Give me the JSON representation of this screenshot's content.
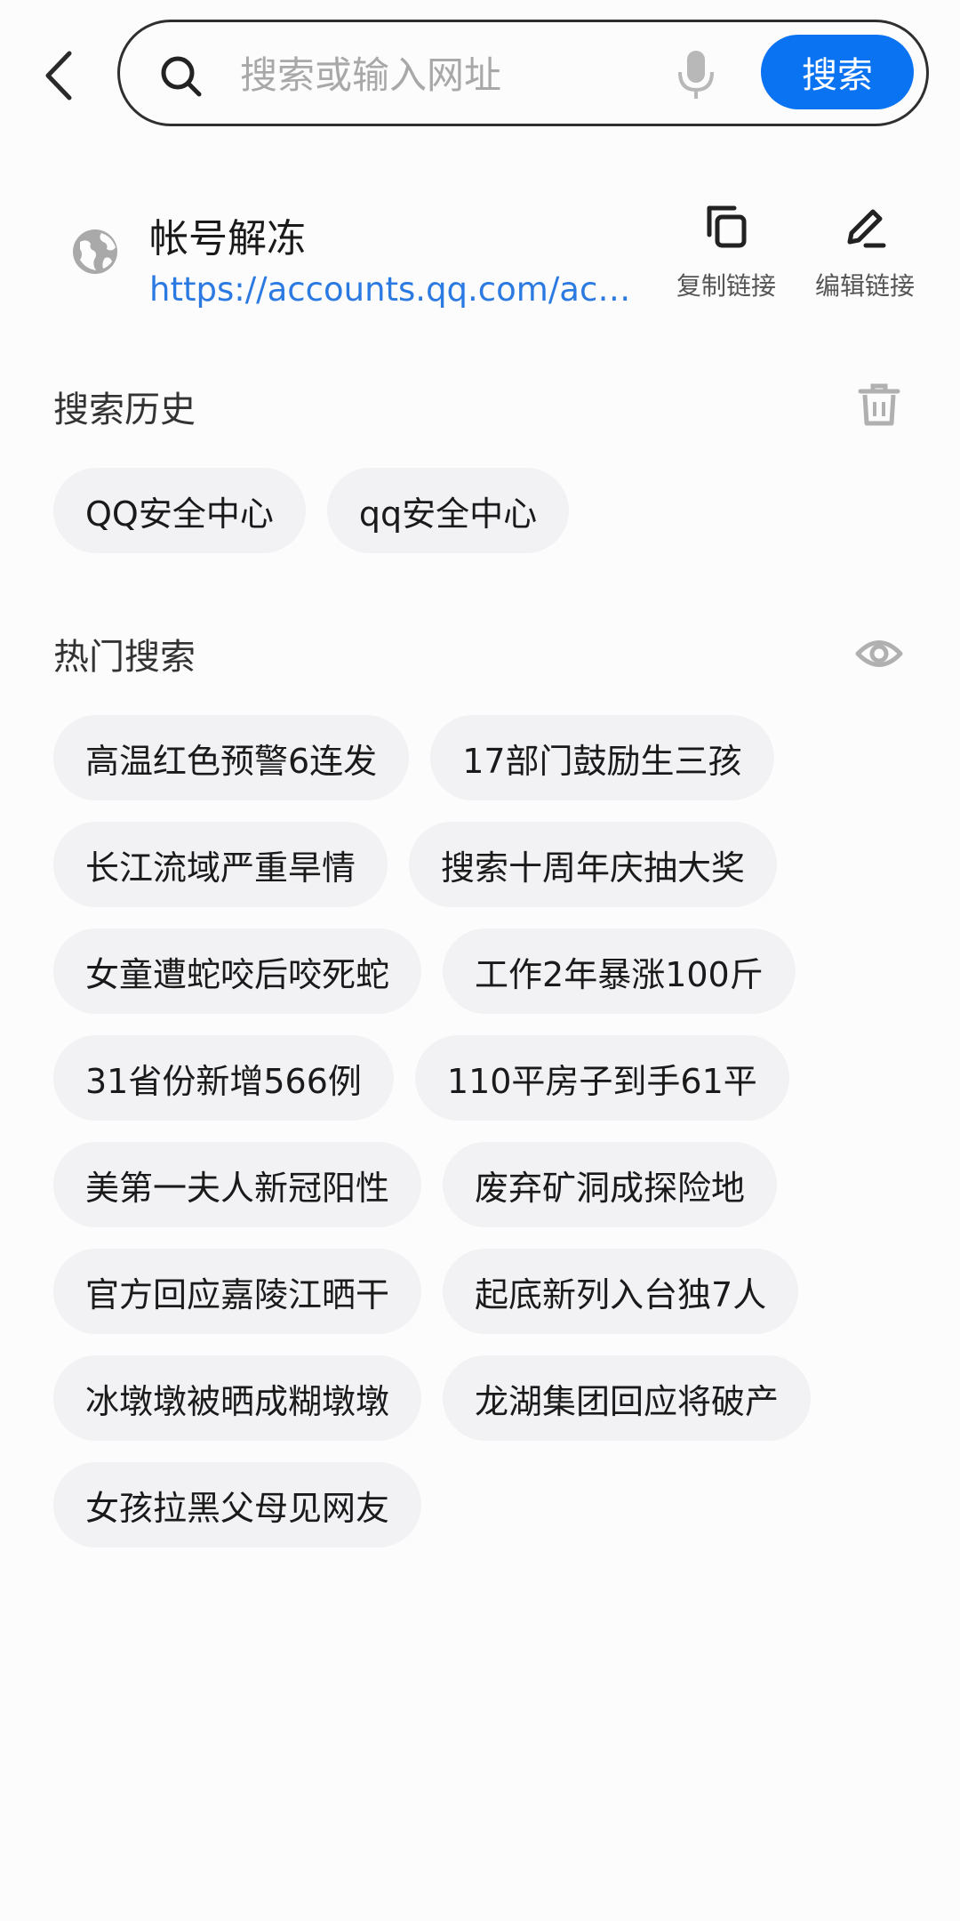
{
  "search": {
    "placeholder": "搜索或输入网址",
    "button_label": "搜索"
  },
  "current_page": {
    "title": "帐号解冻",
    "url": "https://accounts.qq.com/acc…",
    "copy_label": "复制链接",
    "edit_label": "编辑链接"
  },
  "history": {
    "title": "搜索历史",
    "items": [
      "QQ安全中心",
      "qq安全中心"
    ]
  },
  "hot": {
    "title": "热门搜索",
    "items": [
      "高温红色预警6连发",
      "17部门鼓励生三孩",
      "长江流域严重旱情",
      "搜索十周年庆抽大奖",
      "女童遭蛇咬后咬死蛇",
      "工作2年暴涨100斤",
      "31省份新增566例",
      "110平房子到手61平",
      "美第一夫人新冠阳性",
      "废弃矿洞成探险地",
      "官方回应嘉陵江晒干",
      "起底新列入台独7人",
      "冰墩墩被晒成糊墩墩",
      "龙湖集团回应将破产",
      "女孩拉黑父母见网友"
    ]
  },
  "colors": {
    "accent": "#0a73f2",
    "link": "#2a7ae2",
    "chip_bg": "#f2f1f4"
  },
  "icons": [
    "back-arrow-icon",
    "search-icon",
    "microphone-icon",
    "globe-icon",
    "copy-icon",
    "edit-pencil-icon",
    "trash-icon",
    "eye-icon"
  ]
}
